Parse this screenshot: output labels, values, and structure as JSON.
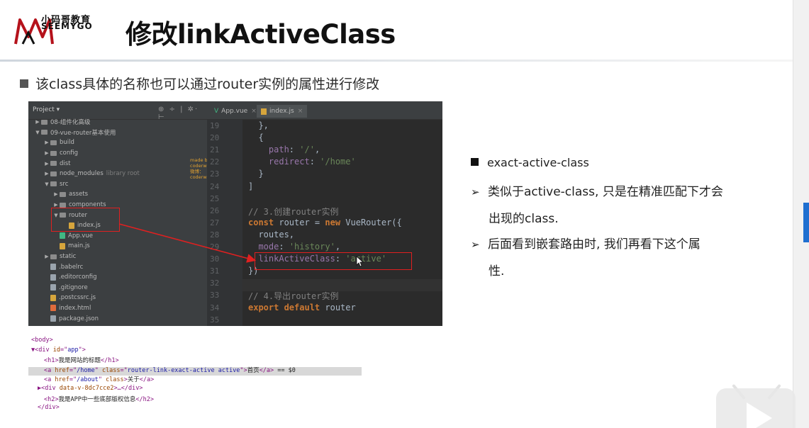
{
  "header": {
    "logo_cn": "小码哥教育",
    "logo_en": "SEEMYGO",
    "title": "修改linkActiveClass"
  },
  "main_bullet": "该class具体的名称也可以通过router实例的属性进行修改",
  "ide": {
    "project_label": "Project  ▾",
    "toolbar_icons": "⊕ ÷ | ✲· ⊢",
    "tabs": [
      "App.vue",
      "index.js"
    ],
    "watermark": [
      "made by coderwhy",
      "微博：coderwhy"
    ],
    "tree": [
      {
        "indent": 0,
        "arrow": "▶",
        "type": "folder",
        "label": "08-组件化高级",
        "dim": ""
      },
      {
        "indent": 0,
        "arrow": "▼",
        "type": "folder",
        "label": "09-vue-router基本使用",
        "dim": ""
      },
      {
        "indent": 1,
        "arrow": "▶",
        "type": "folder",
        "label": "build",
        "dim": ""
      },
      {
        "indent": 1,
        "arrow": "▶",
        "type": "folder",
        "label": "config",
        "dim": ""
      },
      {
        "indent": 1,
        "arrow": "▶",
        "type": "folder",
        "label": "dist",
        "dim": ""
      },
      {
        "indent": 1,
        "arrow": "▶",
        "type": "folder",
        "label": "node_modules",
        "dim": "library root"
      },
      {
        "indent": 1,
        "arrow": "▼",
        "type": "folder",
        "label": "src",
        "dim": ""
      },
      {
        "indent": 2,
        "arrow": "▶",
        "type": "folder",
        "label": "assets",
        "dim": ""
      },
      {
        "indent": 2,
        "arrow": "▶",
        "type": "folder",
        "label": "components",
        "dim": ""
      },
      {
        "indent": 2,
        "arrow": "▼",
        "type": "folder",
        "label": "router",
        "dim": ""
      },
      {
        "indent": 3,
        "arrow": "",
        "type": "js",
        "label": "index.js",
        "dim": ""
      },
      {
        "indent": 2,
        "arrow": "",
        "type": "vue",
        "label": "App.vue",
        "dim": ""
      },
      {
        "indent": 2,
        "arrow": "",
        "type": "js",
        "label": "main.js",
        "dim": ""
      },
      {
        "indent": 1,
        "arrow": "▶",
        "type": "folder",
        "label": "static",
        "dim": ""
      },
      {
        "indent": 1,
        "arrow": "",
        "type": "cfg",
        "label": ".babelrc",
        "dim": ""
      },
      {
        "indent": 1,
        "arrow": "",
        "type": "cfg",
        "label": ".editorconfig",
        "dim": ""
      },
      {
        "indent": 1,
        "arrow": "",
        "type": "cfg",
        "label": ".gitignore",
        "dim": ""
      },
      {
        "indent": 1,
        "arrow": "",
        "type": "js",
        "label": ".postcssrc.js",
        "dim": ""
      },
      {
        "indent": 1,
        "arrow": "",
        "type": "html",
        "label": "index.html",
        "dim": ""
      },
      {
        "indent": 1,
        "arrow": "",
        "type": "cfg",
        "label": "package.json",
        "dim": ""
      }
    ],
    "line_numbers": [
      "19",
      "20",
      "21",
      "22",
      "23",
      "24",
      "25",
      "26",
      "27",
      "28",
      "29",
      "30",
      "31",
      "32",
      "33",
      "34",
      "35"
    ],
    "code": [
      [
        {
          "c": "",
          "t": "  },"
        }
      ],
      [
        {
          "c": "",
          "t": "  {"
        }
      ],
      [
        {
          "c": "prop",
          "t": "    path"
        },
        {
          "c": "",
          "t": ": "
        },
        {
          "c": "str",
          "t": "'/'"
        },
        {
          "c": "",
          "t": ","
        }
      ],
      [
        {
          "c": "prop",
          "t": "    redirect"
        },
        {
          "c": "",
          "t": ": "
        },
        {
          "c": "str",
          "t": "'/home'"
        }
      ],
      [
        {
          "c": "",
          "t": "  }"
        }
      ],
      [
        {
          "c": "",
          "t": "]"
        }
      ],
      [
        {
          "c": "",
          "t": ""
        }
      ],
      [
        {
          "c": "cmt",
          "t": "// 3.创建router实例"
        }
      ],
      [
        {
          "c": "kw",
          "t": "const"
        },
        {
          "c": "",
          "t": " router = "
        },
        {
          "c": "kw",
          "t": "new"
        },
        {
          "c": "",
          "t": " VueRouter({"
        }
      ],
      [
        {
          "c": "",
          "t": "  routes,"
        }
      ],
      [
        {
          "c": "prop",
          "t": "  mode"
        },
        {
          "c": "",
          "t": ": "
        },
        {
          "c": "str",
          "t": "'history'"
        },
        {
          "c": "",
          "t": ","
        }
      ],
      [
        {
          "c": "prop",
          "t": "  linkActiveClass"
        },
        {
          "c": "",
          "t": ": "
        },
        {
          "c": "str",
          "t": "'active'"
        }
      ],
      [
        {
          "c": "",
          "t": "})"
        }
      ],
      [
        {
          "c": "",
          "t": ""
        }
      ],
      [
        {
          "c": "cmt",
          "t": "// 4.导出router实例"
        }
      ],
      [
        {
          "c": "kw",
          "t": "export default"
        },
        {
          "c": "",
          "t": " router"
        }
      ],
      [
        {
          "c": "",
          "t": ""
        }
      ]
    ]
  },
  "dom": {
    "lines": [
      {
        "indent": 0,
        "parts": [
          {
            "c": "tag",
            "t": "<body>"
          }
        ]
      },
      {
        "indent": 0,
        "parts": [
          {
            "c": "tag",
            "t": "▼<div "
          },
          {
            "c": "attr",
            "t": "id"
          },
          {
            "c": "tag",
            "t": "=\""
          },
          {
            "c": "aval",
            "t": "app"
          },
          {
            "c": "tag",
            "t": "\">"
          }
        ]
      },
      {
        "indent": 2,
        "parts": [
          {
            "c": "tag",
            "t": "<h1>"
          },
          {
            "c": "txt",
            "t": "我是网站的标题"
          },
          {
            "c": "tag",
            "t": "</h1>"
          }
        ]
      },
      {
        "indent": 2,
        "parts": [
          {
            "c": "tag",
            "t": "<a "
          },
          {
            "c": "attr",
            "t": "href"
          },
          {
            "c": "tag",
            "t": "=\""
          },
          {
            "c": "aval",
            "t": "/home"
          },
          {
            "c": "tag",
            "t": "\" "
          },
          {
            "c": "attr",
            "t": "class"
          },
          {
            "c": "tag",
            "t": "=\""
          },
          {
            "c": "aval",
            "t": "router-link-exact-active active"
          },
          {
            "c": "tag",
            "t": "\">"
          },
          {
            "c": "txt",
            "t": "首页"
          },
          {
            "c": "tag",
            "t": "</a>"
          },
          {
            "c": "txt",
            "t": " == $0"
          }
        ]
      },
      {
        "indent": 2,
        "parts": [
          {
            "c": "tag",
            "t": "<a "
          },
          {
            "c": "attr",
            "t": "href"
          },
          {
            "c": "tag",
            "t": "=\""
          },
          {
            "c": "aval",
            "t": "/about"
          },
          {
            "c": "tag",
            "t": "\" "
          },
          {
            "c": "attr",
            "t": "class"
          },
          {
            "c": "tag",
            "t": ">"
          },
          {
            "c": "txt",
            "t": "关于"
          },
          {
            "c": "tag",
            "t": "</a>"
          }
        ]
      },
      {
        "indent": 1,
        "parts": [
          {
            "c": "tag",
            "t": "▶<div "
          },
          {
            "c": "attr",
            "t": "data-v-8dc7cce2"
          },
          {
            "c": "tag",
            "t": ">…</div>"
          }
        ]
      },
      {
        "indent": 2,
        "parts": [
          {
            "c": "tag",
            "t": "<h2>"
          },
          {
            "c": "txt",
            "t": "我是APP中一些底部版权信息"
          },
          {
            "c": "tag",
            "t": "</h2>"
          }
        ]
      },
      {
        "indent": 1,
        "parts": [
          {
            "c": "tag",
            "t": "</div>"
          }
        ]
      }
    ]
  },
  "right": {
    "heading": "exact-active-class",
    "items": [
      {
        "line1": "类似于active-class, 只是在精准匹配下才会",
        "line2": "出现的class."
      },
      {
        "line1": "后面看到嵌套路由时, 我们再看下这个属",
        "line2": "性."
      }
    ]
  },
  "colors": {
    "accent_blue": "#1f6fd0",
    "highlight_red": "#e02020",
    "ide_bg": "#2b2b2b"
  }
}
